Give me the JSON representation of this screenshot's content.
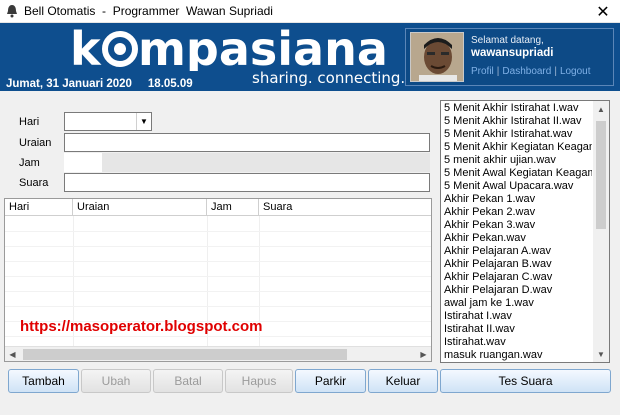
{
  "window": {
    "title": "Bell Otomatis  -  Programmer  Wawan Supriadi",
    "close_glyph": "✕"
  },
  "header": {
    "date_text": "Jumat, 31 Januari 2020     18.05.09",
    "logo_text_k": "k",
    "logo_text_rest": "mpasiana",
    "tagline": "sharing. connecting.",
    "brand_color": "#0e4e8e",
    "user": {
      "greeting": "Selamat datang,",
      "username": "wawansupriadi",
      "link_profil": "Profil",
      "link_dashboard": "Dashboard",
      "link_logout": "Logout",
      "separator": "|"
    }
  },
  "form": {
    "labels": {
      "hari": "Hari",
      "uraian": "Uraian",
      "jam": "Jam",
      "suara": "Suara"
    },
    "hari_value": "",
    "uraian_value": "",
    "jam_value": "",
    "suara_value": ""
  },
  "grid": {
    "columns": [
      "Hari",
      "Uraian",
      "Jam",
      "Suara"
    ],
    "rows": []
  },
  "overlay_url": "https://masoperator.blogspot.com",
  "file_list": [
    "5 Menit Akhir Istirahat I.wav",
    "5 Menit Akhir Istirahat II.wav",
    "5 Menit Akhir Istirahat.wav",
    "5 Menit Akhir Kegiatan Keagam",
    "5 menit akhir ujian.wav",
    "5 Menit Awal Kegiatan Keagam",
    "5 Menit Awal Upacara.wav",
    "Akhir Pekan 1.wav",
    "Akhir Pekan 2.wav",
    "Akhir Pekan 3.wav",
    "Akhir Pekan.wav",
    "Akhir Pelajaran A.wav",
    "Akhir Pelajaran B.wav",
    "Akhir Pelajaran C.wav",
    "Akhir Pelajaran D.wav",
    "awal jam ke 1.wav",
    "Istirahat I.wav",
    "Istirahat II.wav",
    "Istirahat.wav",
    "masuk ruangan.wav"
  ],
  "buttons": {
    "tambah": "Tambah",
    "ubah": "Ubah",
    "batal": "Batal",
    "hapus": "Hapus",
    "parkir": "Parkir",
    "keluar": "Keluar",
    "tes_suara": "Tes Suara"
  },
  "icons": {
    "app": "bell-icon",
    "dropdown": "chevron-down-icon",
    "scroll_left": "arrow-left-icon",
    "scroll_right": "arrow-right-icon",
    "scroll_up": "arrow-up-icon",
    "scroll_down": "arrow-down-icon"
  }
}
